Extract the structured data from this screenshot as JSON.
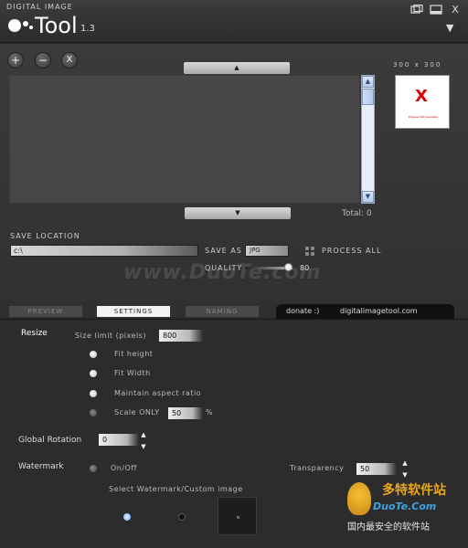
{
  "app": {
    "brand_small": "DIGITAL IMAGE",
    "name": "Tool",
    "version": "1.3",
    "window_buttons": [
      "restore-icon",
      "minimize-icon",
      "close-icon"
    ],
    "close_label": "X",
    "menu_chevron": "▼"
  },
  "toolbar": {
    "add_label": "+",
    "remove_label": "−",
    "clear_label": "X"
  },
  "list": {
    "scroll_up": "▲",
    "scroll_down": "▼",
    "total": "Total: 0"
  },
  "preview": {
    "dimensions": "300 x 300",
    "thumb_mark": "X",
    "thumb_caption": "Preview Not Available"
  },
  "output": {
    "save_location_label": "SAVE LOCATION",
    "save_location_value": "c:\\",
    "save_as_label": "SAVE AS",
    "save_as_value": "JPG",
    "process_all_label": "PROCESS ALL",
    "quality_label": "QUALITY",
    "quality_value": "80",
    "quality_fraction": 0.8
  },
  "brand_watermark": "www.DuoTe.com",
  "tabs": [
    {
      "label": "PREVIEW",
      "active": false
    },
    {
      "label": "SETTINGS",
      "active": true
    },
    {
      "label": "NAMING",
      "active": false
    }
  ],
  "links": {
    "donate": "donate :)",
    "site": "digitalimagetool.com"
  },
  "settings": {
    "resize_label": "Resize",
    "size_limit_label": "Size limit (pixels)",
    "size_limit_value": "800",
    "fit_height": "Fit height",
    "fit_width": "Fit Width",
    "maintain_aspect": "Maintain aspect ratio",
    "scale_only": "Scale ONLY",
    "scale_value": "50",
    "scale_unit": "%",
    "rotation_label": "Global Rotation",
    "rotation_value": "0",
    "watermark_label": "Watermark",
    "watermark_toggle": "On/Off",
    "transparency_label": "Transparency",
    "transparency_value": "50",
    "select_watermark_label": "Select Watermark/Custom image"
  },
  "site_badge": {
    "title": "多特软件站",
    "domain": "DuoTe.Com",
    "slogan": "国内最安全的软件站"
  },
  "colors": {
    "background": "#2a2a2a",
    "panel": "#3b3b3b",
    "active_tab": "#f2f2f2",
    "accent_red": "#dd0000",
    "radio_blue": "#6aa8ff"
  }
}
